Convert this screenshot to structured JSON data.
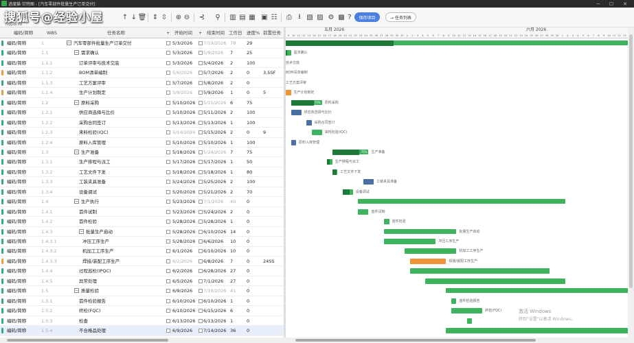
{
  "window": {
    "title": "进度猫·甘特图 - [汽车零部件批量生产订单交付]"
  },
  "watermark": {
    "text": "搜狐号@经验小屋",
    "sub": "Fxygnas.net"
  },
  "toolbar": {
    "save_label": "保存项目",
    "tasklist_label": "→ 任务列表"
  },
  "grid_header": {
    "code": "编码/简称",
    "wbs": "WBS",
    "name": "任务名称",
    "add": "+",
    "start": "开始时间",
    "add2": "+",
    "end": "结束时间",
    "days": "工作日",
    "progress": "进度%",
    "pred": "前置任务"
  },
  "rows": [
    {
      "code": "编码/简称",
      "wbs": "1",
      "name": "汽车零部件批量生产订单交付",
      "start": "5/3/2026",
      "end": "7/19/2026",
      "days": "78",
      "progress": "29",
      "pred": "",
      "level": 0,
      "tog": "−",
      "endGray": true,
      "daysGray": true,
      "mark": "#3a8"
    },
    {
      "code": "编码/简称",
      "wbs": "1.1",
      "name": "需求确认",
      "start": "5/3/2026",
      "end": "5/9/2026",
      "days": "7",
      "progress": "25",
      "pred": "",
      "level": 1,
      "tog": "−",
      "endGray": true,
      "daysGray": false,
      "mark": "#3a8"
    },
    {
      "code": "编码/简称",
      "wbs": "1.1.1",
      "name": "订单评审与技术交底",
      "start": "5/3/2026",
      "end": "5/4/2026",
      "days": "2",
      "progress": "100",
      "pred": "",
      "level": 2,
      "tog": "",
      "endGray": false,
      "daysGray": false,
      "mark": "#3a8"
    },
    {
      "code": "编码/简称",
      "wbs": "1.1.2",
      "name": "BOM清单编制",
      "start": "5/6/2026",
      "end": "5/7/2026",
      "days": "2",
      "progress": "0",
      "pred": "3,5SF",
      "level": 2,
      "tog": "",
      "endGray": false,
      "daysGray": false,
      "startGray": true,
      "mark": "#e94"
    },
    {
      "code": "编码/简称",
      "wbs": "1.1.3",
      "name": "工艺方案评审",
      "start": "5/7/2026",
      "end": "5/8/2026",
      "days": "2",
      "progress": "0",
      "pred": "",
      "level": 2,
      "tog": "",
      "endGray": false,
      "daysGray": false,
      "mark": "#3a8"
    },
    {
      "code": "编码/简称",
      "wbs": "1.1.4",
      "name": "生产计划制定",
      "start": "5/9/2026",
      "end": "5/9/2026",
      "days": "1",
      "progress": "0",
      "pred": "5",
      "level": 2,
      "tog": "",
      "endGray": false,
      "daysGray": false,
      "startGray": true,
      "mark": "#e94"
    },
    {
      "code": "编码/简称",
      "wbs": "1.2",
      "name": "原料采购",
      "start": "5/10/2026",
      "end": "5/15/2026",
      "days": "6",
      "progress": "75",
      "pred": "",
      "level": 1,
      "tog": "−",
      "endGray": true,
      "daysGray": false,
      "mark": "#3a8"
    },
    {
      "code": "编码/简称",
      "wbs": "1.2.1",
      "name": "供应商选择与比价",
      "start": "5/10/2026",
      "end": "5/11/2026",
      "days": "2",
      "progress": "100",
      "pred": "",
      "level": 2,
      "tog": "",
      "endGray": false,
      "daysGray": false,
      "mark": "#3a8"
    },
    {
      "code": "编码/简称",
      "wbs": "1.2.2",
      "name": "采购合同签订",
      "start": "5/13/2026",
      "end": "5/13/2026",
      "days": "1",
      "progress": "100",
      "pred": "",
      "level": 2,
      "tog": "",
      "endGray": false,
      "daysGray": false,
      "mark": "#3a8"
    },
    {
      "code": "编码/简称",
      "wbs": "1.2.3",
      "name": "来料检验(IQC)",
      "start": "5/14/2026",
      "end": "5/15/2026",
      "days": "2",
      "progress": "0",
      "pred": "9",
      "level": 2,
      "tog": "",
      "endGray": false,
      "daysGray": false,
      "startGray": true,
      "mark": "#3a8"
    },
    {
      "code": "编码/简称",
      "wbs": "1.2.4",
      "name": "原料入库管理",
      "start": "5/10/2026",
      "end": "5/10/2026",
      "days": "1",
      "progress": "100",
      "pred": "",
      "level": 2,
      "tog": "",
      "endGray": false,
      "daysGray": false,
      "mark": "#3a8"
    },
    {
      "code": "编码/简称",
      "wbs": "1.3",
      "name": "生产准备",
      "start": "5/18/2026",
      "end": "5/24/2026",
      "days": "7",
      "progress": "75",
      "pred": "",
      "level": 1,
      "tog": "−",
      "endGray": true,
      "daysGray": false,
      "mark": "#3a8"
    },
    {
      "code": "编码/简称",
      "wbs": "1.3.1",
      "name": "生产排程与派工",
      "start": "5/17/2026",
      "end": "5/17/2026",
      "days": "1",
      "progress": "50",
      "pred": "",
      "level": 2,
      "tog": "",
      "endGray": false,
      "daysGray": false,
      "mark": "#3a8"
    },
    {
      "code": "编码/简称",
      "wbs": "1.3.2",
      "name": "工艺文件下发",
      "start": "5/18/2026",
      "end": "5/18/2026",
      "days": "1",
      "progress": "80",
      "pred": "",
      "level": 2,
      "tog": "",
      "endGray": false,
      "daysGray": false,
      "mark": "#3a8"
    },
    {
      "code": "编码/简称",
      "wbs": "1.3.3",
      "name": "工装夹具准备",
      "start": "5/24/2026",
      "end": "5/25/2026",
      "days": "2",
      "progress": "100",
      "pred": "",
      "level": 2,
      "tog": "",
      "endGray": false,
      "daysGray": false,
      "mark": "#3a8"
    },
    {
      "code": "编码/简称",
      "wbs": "1.3.4",
      "name": "设备调试",
      "start": "5/20/2026",
      "end": "5/21/2026",
      "days": "2",
      "progress": "70",
      "pred": "",
      "level": 2,
      "tog": "",
      "endGray": false,
      "daysGray": false,
      "mark": "#3a8"
    },
    {
      "code": "编码/简称",
      "wbs": "1.4",
      "name": "生产执行",
      "start": "5/23/2026",
      "end": "7/1/2026",
      "days": "40",
      "progress": "0",
      "pred": "",
      "level": 1,
      "tog": "−",
      "endGray": true,
      "daysGray": true,
      "mark": "#3a8"
    },
    {
      "code": "编码/简称",
      "wbs": "1.4.1",
      "name": "首件试制",
      "start": "5/23/2026",
      "end": "5/24/2026",
      "days": "2",
      "progress": "0",
      "pred": "",
      "level": 2,
      "tog": "",
      "endGray": false,
      "daysGray": false,
      "mark": "#3a8"
    },
    {
      "code": "编码/简称",
      "wbs": "1.4.2",
      "name": "首件检验",
      "start": "5/28/2026",
      "end": "5/28/2026",
      "days": "1",
      "progress": "0",
      "pred": "",
      "level": 2,
      "tog": "",
      "endGray": false,
      "daysGray": false,
      "mark": "#3a8"
    },
    {
      "code": "编码/简称",
      "wbs": "1.4.3",
      "name": "批量生产启动",
      "start": "5/28/2026",
      "end": "6/10/2026",
      "days": "14",
      "progress": "0",
      "pred": "",
      "level": 2,
      "tog": "−",
      "endGray": false,
      "daysGray": false,
      "mark": "#3a8"
    },
    {
      "code": "编码/简称",
      "wbs": "1.4.3.1",
      "name": "冲压工序生产",
      "start": "5/28/2026",
      "end": "6/6/2026",
      "days": "10",
      "progress": "0",
      "pred": "",
      "level": 3,
      "tog": "",
      "endGray": false,
      "daysGray": false,
      "mark": "#3a8"
    },
    {
      "code": "编码/简称",
      "wbs": "1.4.3.2",
      "name": "机加工工序生产",
      "start": "6/1/2026",
      "end": "6/10/2026",
      "days": "10",
      "progress": "0",
      "pred": "",
      "level": 3,
      "tog": "",
      "endGray": false,
      "daysGray": false,
      "mark": "#3a8"
    },
    {
      "code": "编码/简称",
      "wbs": "1.4.3.3",
      "name": "焊接/装配工序生产",
      "start": "6/2/2026",
      "end": "6/8/2026",
      "days": "7",
      "progress": "0",
      "pred": "24SS",
      "level": 3,
      "tog": "",
      "endGray": false,
      "daysGray": false,
      "startGray": true,
      "mark": "#e94"
    },
    {
      "code": "编码/简称",
      "wbs": "1.4.4",
      "name": "过程巡检(IPQC)",
      "start": "6/2/2026",
      "end": "6/28/2026",
      "days": "27",
      "progress": "0",
      "pred": "",
      "level": 2,
      "tog": "",
      "endGray": false,
      "daysGray": false,
      "mark": "#3a8"
    },
    {
      "code": "编码/简称",
      "wbs": "1.4.5",
      "name": "异常处理",
      "start": "6/5/2026",
      "end": "7/1/2026",
      "days": "27",
      "progress": "0",
      "pred": "",
      "level": 2,
      "tog": "",
      "endGray": false,
      "daysGray": false,
      "mark": "#3a8"
    },
    {
      "code": "编码/简称",
      "wbs": "1.5",
      "name": "质量检验",
      "start": "6/9/2026",
      "end": "7/19/2026",
      "days": "41",
      "progress": "0",
      "pred": "",
      "level": 1,
      "tog": "−",
      "endGray": true,
      "daysGray": true,
      "mark": "#3a8"
    },
    {
      "code": "编码/简称",
      "wbs": "1.5.1",
      "name": "首件检验报告",
      "start": "6/10/2026",
      "end": "6/10/2026",
      "days": "1",
      "progress": "0",
      "pred": "",
      "level": 2,
      "tog": "",
      "endGray": false,
      "daysGray": false,
      "mark": "#3a8"
    },
    {
      "code": "编码/简称",
      "wbs": "1.5.2",
      "name": "终检(FQC)",
      "start": "6/10/2026",
      "end": "6/15/2026",
      "days": "6",
      "progress": "0",
      "pred": "",
      "level": 2,
      "tog": "",
      "endGray": false,
      "daysGray": false,
      "mark": "#3a8"
    },
    {
      "code": "编码/简称",
      "wbs": "1.5.3",
      "name": "检查",
      "start": "6/13/2026",
      "end": "6/13/2026",
      "days": "1",
      "progress": "0",
      "pred": "",
      "level": 2,
      "tog": "",
      "endGray": false,
      "daysGray": false,
      "mark": "#3a8"
    },
    {
      "code": "编码/简称",
      "wbs": "1.5.4",
      "name": "不合格品处理",
      "start": "6/9/2026",
      "end": "7/14/2026",
      "days": "36",
      "progress": "0",
      "pred": "",
      "level": 2,
      "tog": "",
      "endGray": false,
      "daysGray": false,
      "mark": "#3a8",
      "selected": true
    }
  ],
  "gantt": {
    "months": [
      {
        "label": "五月 2026"
      },
      {
        "label": "六月 2026"
      }
    ],
    "days": [
      "9",
      "10",
      "11",
      "12",
      "13",
      "14",
      "15",
      "16",
      "17",
      "18",
      "19",
      "20",
      "21",
      "22",
      "23",
      "24",
      "25",
      "26",
      "27",
      "28",
      "29",
      "30",
      "31",
      "1",
      "2",
      "3",
      "4",
      "5",
      "6",
      "7",
      "8",
      "9",
      "10",
      "11",
      "12",
      "13",
      "14",
      "15",
      "16",
      "17",
      "18",
      "19",
      "20",
      "21",
      "22",
      "23",
      "24",
      "25",
      "26",
      "27",
      "28",
      "29",
      "30",
      "1",
      "2",
      "3",
      "4",
      "5",
      "6",
      "7",
      "8",
      "9",
      "10",
      "11",
      "12",
      "13"
    ],
    "bars": [
      {
        "row": 0,
        "type": "summary",
        "label": "",
        "pct": "29%"
      },
      {
        "row": 1,
        "type": "task",
        "label": "需求确认",
        "pct": ""
      },
      {
        "row": 2,
        "type": "none",
        "label": "技术交底",
        "pct": ""
      },
      {
        "row": 3,
        "type": "none",
        "label": "BOM清单编制",
        "pct": ""
      },
      {
        "row": 4,
        "type": "none",
        "label": "工艺方案评审",
        "pct": ""
      },
      {
        "row": 5,
        "type": "orange",
        "label": "生产计划制定",
        "pct": ""
      },
      {
        "row": 6,
        "type": "summary",
        "label": "原料采购",
        "pct": "75%"
      },
      {
        "row": 7,
        "type": "blue",
        "label": "供应商选择与比价",
        "pct": ""
      },
      {
        "row": 8,
        "type": "blue",
        "label": "采购合同签订",
        "pct": ""
      },
      {
        "row": 9,
        "type": "task",
        "label": "来料检验(IQC)",
        "pct": ""
      },
      {
        "row": 10,
        "type": "blue",
        "label": "原料入库管理",
        "pct": ""
      },
      {
        "row": 11,
        "type": "summary",
        "label": "生产准备",
        "pct": "75%"
      },
      {
        "row": 12,
        "type": "task",
        "label": "生产排程与派工",
        "pct": ""
      },
      {
        "row": 13,
        "type": "task",
        "label": "工艺文件下发",
        "pct": ""
      },
      {
        "row": 14,
        "type": "blue",
        "label": "工装夹具准备",
        "pct": ""
      },
      {
        "row": 15,
        "type": "task",
        "label": "设备调试",
        "pct": ""
      },
      {
        "row": 16,
        "type": "summary",
        "label": "",
        "pct": ""
      },
      {
        "row": 17,
        "type": "task",
        "label": "首件试制",
        "pct": ""
      },
      {
        "row": 18,
        "type": "task",
        "label": "首件检验",
        "pct": ""
      },
      {
        "row": 19,
        "type": "summary",
        "label": "批量生产启动",
        "pct": ""
      },
      {
        "row": 20,
        "type": "task",
        "label": "冲压工序生产",
        "pct": ""
      },
      {
        "row": 21,
        "type": "task",
        "label": "机加工工序生产",
        "pct": ""
      },
      {
        "row": 22,
        "type": "orange",
        "label": "焊接/装配工序生产",
        "pct": ""
      },
      {
        "row": 23,
        "type": "task",
        "label": "",
        "pct": ""
      },
      {
        "row": 24,
        "type": "task",
        "label": "",
        "pct": ""
      },
      {
        "row": 25,
        "type": "summary",
        "label": "",
        "pct": ""
      },
      {
        "row": 26,
        "type": "task",
        "label": "首件检验报告",
        "pct": ""
      },
      {
        "row": 27,
        "type": "task",
        "label": "终检(FQC)",
        "pct": ""
      },
      {
        "row": 28,
        "type": "task",
        "label": "",
        "pct": ""
      },
      {
        "row": 29,
        "type": "task",
        "label": "",
        "pct": ""
      }
    ]
  },
  "activation": {
    "line1": "激活 Windows",
    "line2": "转到\"设置\"以激活 Windows。"
  },
  "colors": {
    "green": "#3cb35c",
    "darkgreen": "#1f7a3a",
    "orange": "#f0923a",
    "blue": "#4a6fa5",
    "accent": "#4a7fe0"
  }
}
